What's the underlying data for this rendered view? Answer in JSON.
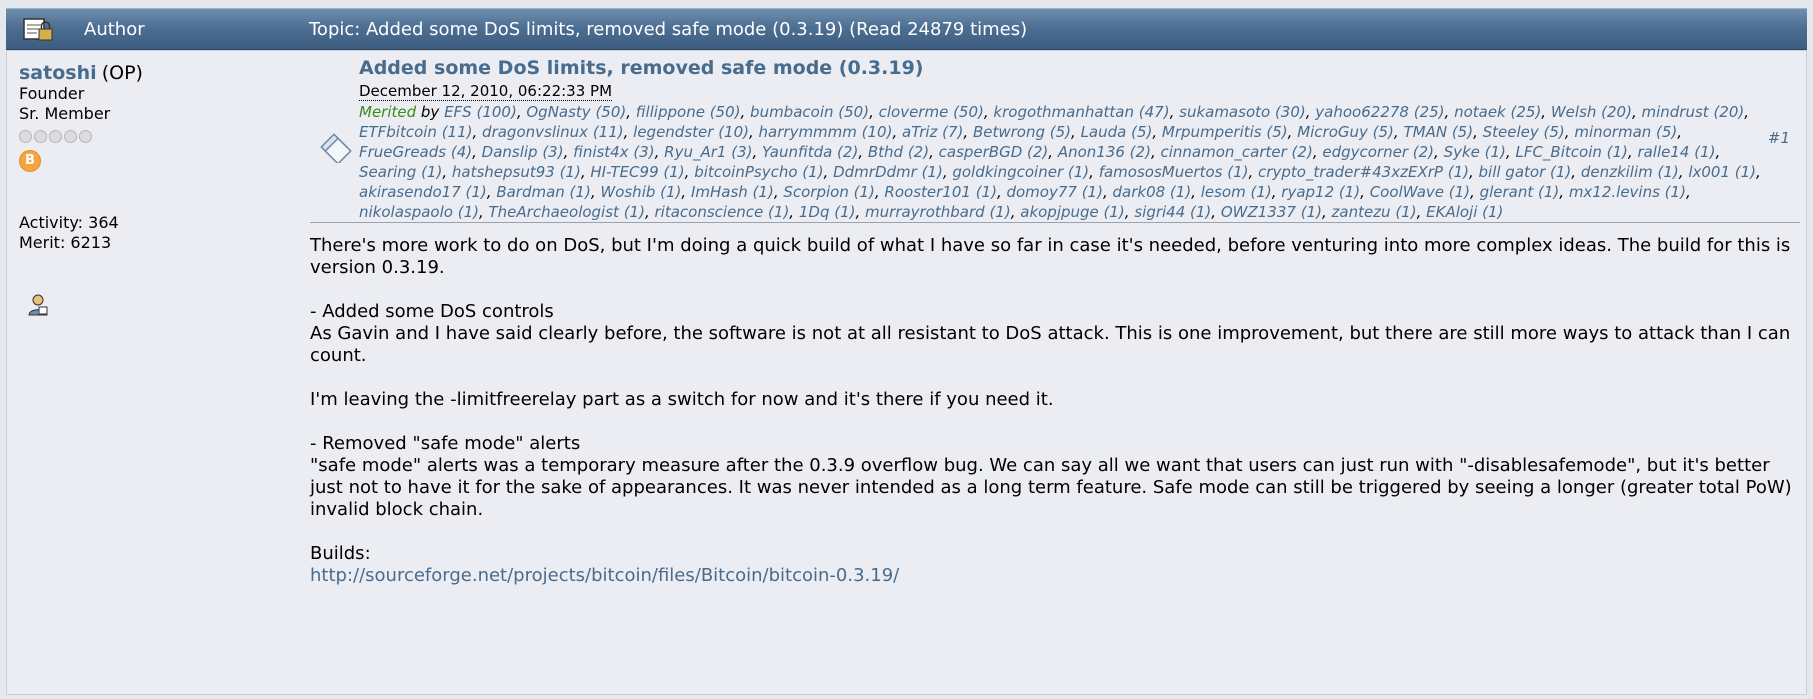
{
  "header": {
    "author_label": "Author",
    "topic_text": "Topic: Added some DoS limits, removed safe mode (0.3.19)  (Read 24879 times)"
  },
  "poster": {
    "username": "satoshi",
    "op_tag": "(OP)",
    "role": "Founder",
    "rank": "Sr. Member",
    "badge_letter": "B",
    "activity": "Activity: 364",
    "merit": "Merit: 6213"
  },
  "post": {
    "title": "Added some DoS limits, removed safe mode (0.3.19)",
    "date": "December 12, 2010, 06:22:33 PM",
    "number": "#1",
    "merited_label": "Merited",
    "merited_by": " by ",
    "merits": [
      "EFS (100)",
      "OgNasty (50)",
      "fillippone (50)",
      "bumbacoin (50)",
      "cloverme (50)",
      "krogothmanhattan (47)",
      "sukamasoto (30)",
      "yahoo62278 (25)",
      "notaek (25)",
      "Welsh (20)",
      "mindrust (20)",
      "ETFbitcoin (11)",
      "dragonvslinux (11)",
      "legendster (10)",
      "harrymmmm (10)",
      "aTriz (7)",
      "Betwrong (5)",
      "Lauda (5)",
      "Mrpumperitis (5)",
      "MicroGuy (5)",
      "TMAN (5)",
      "Steeley (5)",
      "minorman (5)",
      "FrueGreads (4)",
      "Danslip (3)",
      "finist4x (3)",
      "Ryu_Ar1 (3)",
      "Yaunfitda (2)",
      "Bthd (2)",
      "casperBGD (2)",
      "Anon136 (2)",
      "cinnamon_carter (2)",
      "edgycorner (2)",
      "Syke (1)",
      "LFC_Bitcoin (1)",
      "ralle14 (1)",
      "Searing (1)",
      "hatshepsut93 (1)",
      "HI-TEC99 (1)",
      "bitcoinPsycho (1)",
      "DdmrDdmr (1)",
      "goldkingcoiner (1)",
      "famososMuertos (1)",
      "crypto_trader#43xzEXrP (1)",
      "bill gator (1)",
      "denzkilim (1)",
      "lx001 (1)",
      "akirasendo17 (1)",
      "Bardman (1)",
      "Woshib (1)",
      "ImHash (1)",
      "Scorpion (1)",
      "Rooster101 (1)",
      "domoy77 (1)",
      "dark08 (1)",
      "lesom (1)",
      "ryap12 (1)",
      "CoolWave (1)",
      "glerant (1)",
      "mx12.levins (1)",
      "nikolaspaolo (1)",
      "TheArchaeologist (1)",
      "ritaconscience (1)",
      "1Dq (1)",
      "murrayrothbard (1)",
      "akopjpuge (1)",
      "sigri44 (1)",
      "OWZ1337 (1)",
      "zantezu (1)",
      "EKAloji (1)"
    ],
    "body": {
      "p1": "There's more work to do on DoS, but I'm doing a quick build of what I have so far in case it's needed, before venturing into more complex ideas.  The build for this is version 0.3.19.",
      "p2a": "- Added some DoS controls",
      "p2b": "As Gavin and I have said clearly before, the software is not at all resistant to DoS attack.  This is one improvement, but there are still more ways to attack than I can count.",
      "p3": "I'm leaving the -limitfreerelay part as a switch for now and it's there if you need it.",
      "p4a": "- Removed \"safe mode\" alerts",
      "p4b": "\"safe mode\" alerts was a temporary measure after the 0.3.9 overflow bug.  We can say all we want that users can just run with \"-disablesafemode\", but it's better just not to have it for the sake of appearances.  It was never intended as a long term feature.  Safe mode can still be triggered by seeing a longer (greater total PoW) invalid block chain.",
      "p5a": "Builds:",
      "link": "http://sourceforge.net/projects/bitcoin/files/Bitcoin/bitcoin-0.3.19/"
    }
  },
  "colors": {
    "header_top": "#6f8fad",
    "header_bottom": "#3c5d80",
    "link": "#476c8e",
    "merited": "#3a8a1e",
    "background": "#ecedf3"
  },
  "icons": [
    "lock-topic-icon",
    "post-icon",
    "profile-icon",
    "bitcoin-badge-icon"
  ]
}
